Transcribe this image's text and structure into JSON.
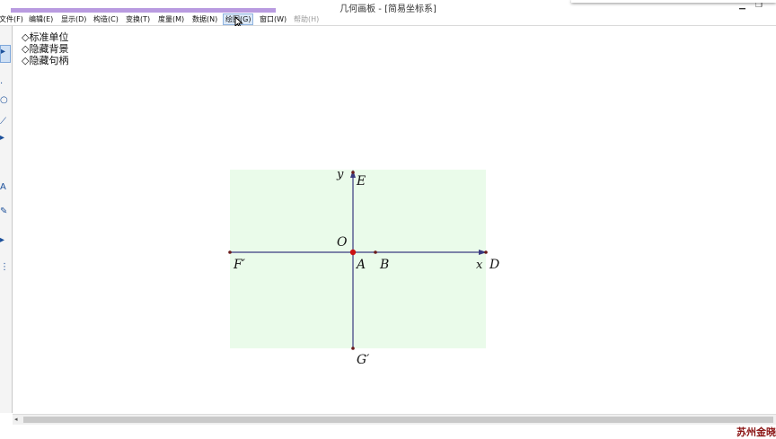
{
  "window": {
    "title": "几何画板 - [简易坐标系]",
    "minimize": "▁",
    "restore": "❐"
  },
  "menu": [
    {
      "label": "文件(F)"
    },
    {
      "label": "编辑(E)"
    },
    {
      "label": "显示(D)"
    },
    {
      "label": "构造(C)"
    },
    {
      "label": "变换(T)"
    },
    {
      "label": "度量(M)"
    },
    {
      "label": "数据(N)"
    },
    {
      "label": "绘图(G)",
      "active": true
    },
    {
      "label": "窗口(W)"
    },
    {
      "label": "帮助(H)",
      "disabled": true
    }
  ],
  "toolbox": {
    "tools": [
      {
        "name": "arrow-tool-icon",
        "glyph": "▸"
      },
      {
        "name": "point-tool-icon",
        "glyph": "·"
      },
      {
        "name": "compass-tool-icon",
        "glyph": "○"
      },
      {
        "name": "straightedge-tool-icon",
        "glyph": "⟋"
      },
      {
        "name": "polygon-tool-icon",
        "glyph": "▸"
      },
      {
        "name": "text-tool-icon",
        "glyph": "A"
      },
      {
        "name": "marker-tool-icon",
        "glyph": "✎"
      },
      {
        "name": "info-tool-icon",
        "glyph": "▸"
      },
      {
        "name": "custom-tool-icon",
        "glyph": "⋮"
      }
    ]
  },
  "action_buttons": [
    {
      "label": "◇标准单位"
    },
    {
      "label": "◇隐藏背景"
    },
    {
      "label": "◇隐藏句柄"
    }
  ],
  "sketch": {
    "background_color": "#eafbea",
    "axis_color": "#3a3a80",
    "origin_color": "#cc1111",
    "axis_labels": {
      "x": "x",
      "y": "y"
    },
    "points": {
      "origin": "O",
      "a": "A",
      "b": "B",
      "d": "D",
      "e": "E",
      "f": "F′",
      "g": "G′"
    }
  },
  "statusbar": {
    "watermark": "苏州金晓"
  }
}
